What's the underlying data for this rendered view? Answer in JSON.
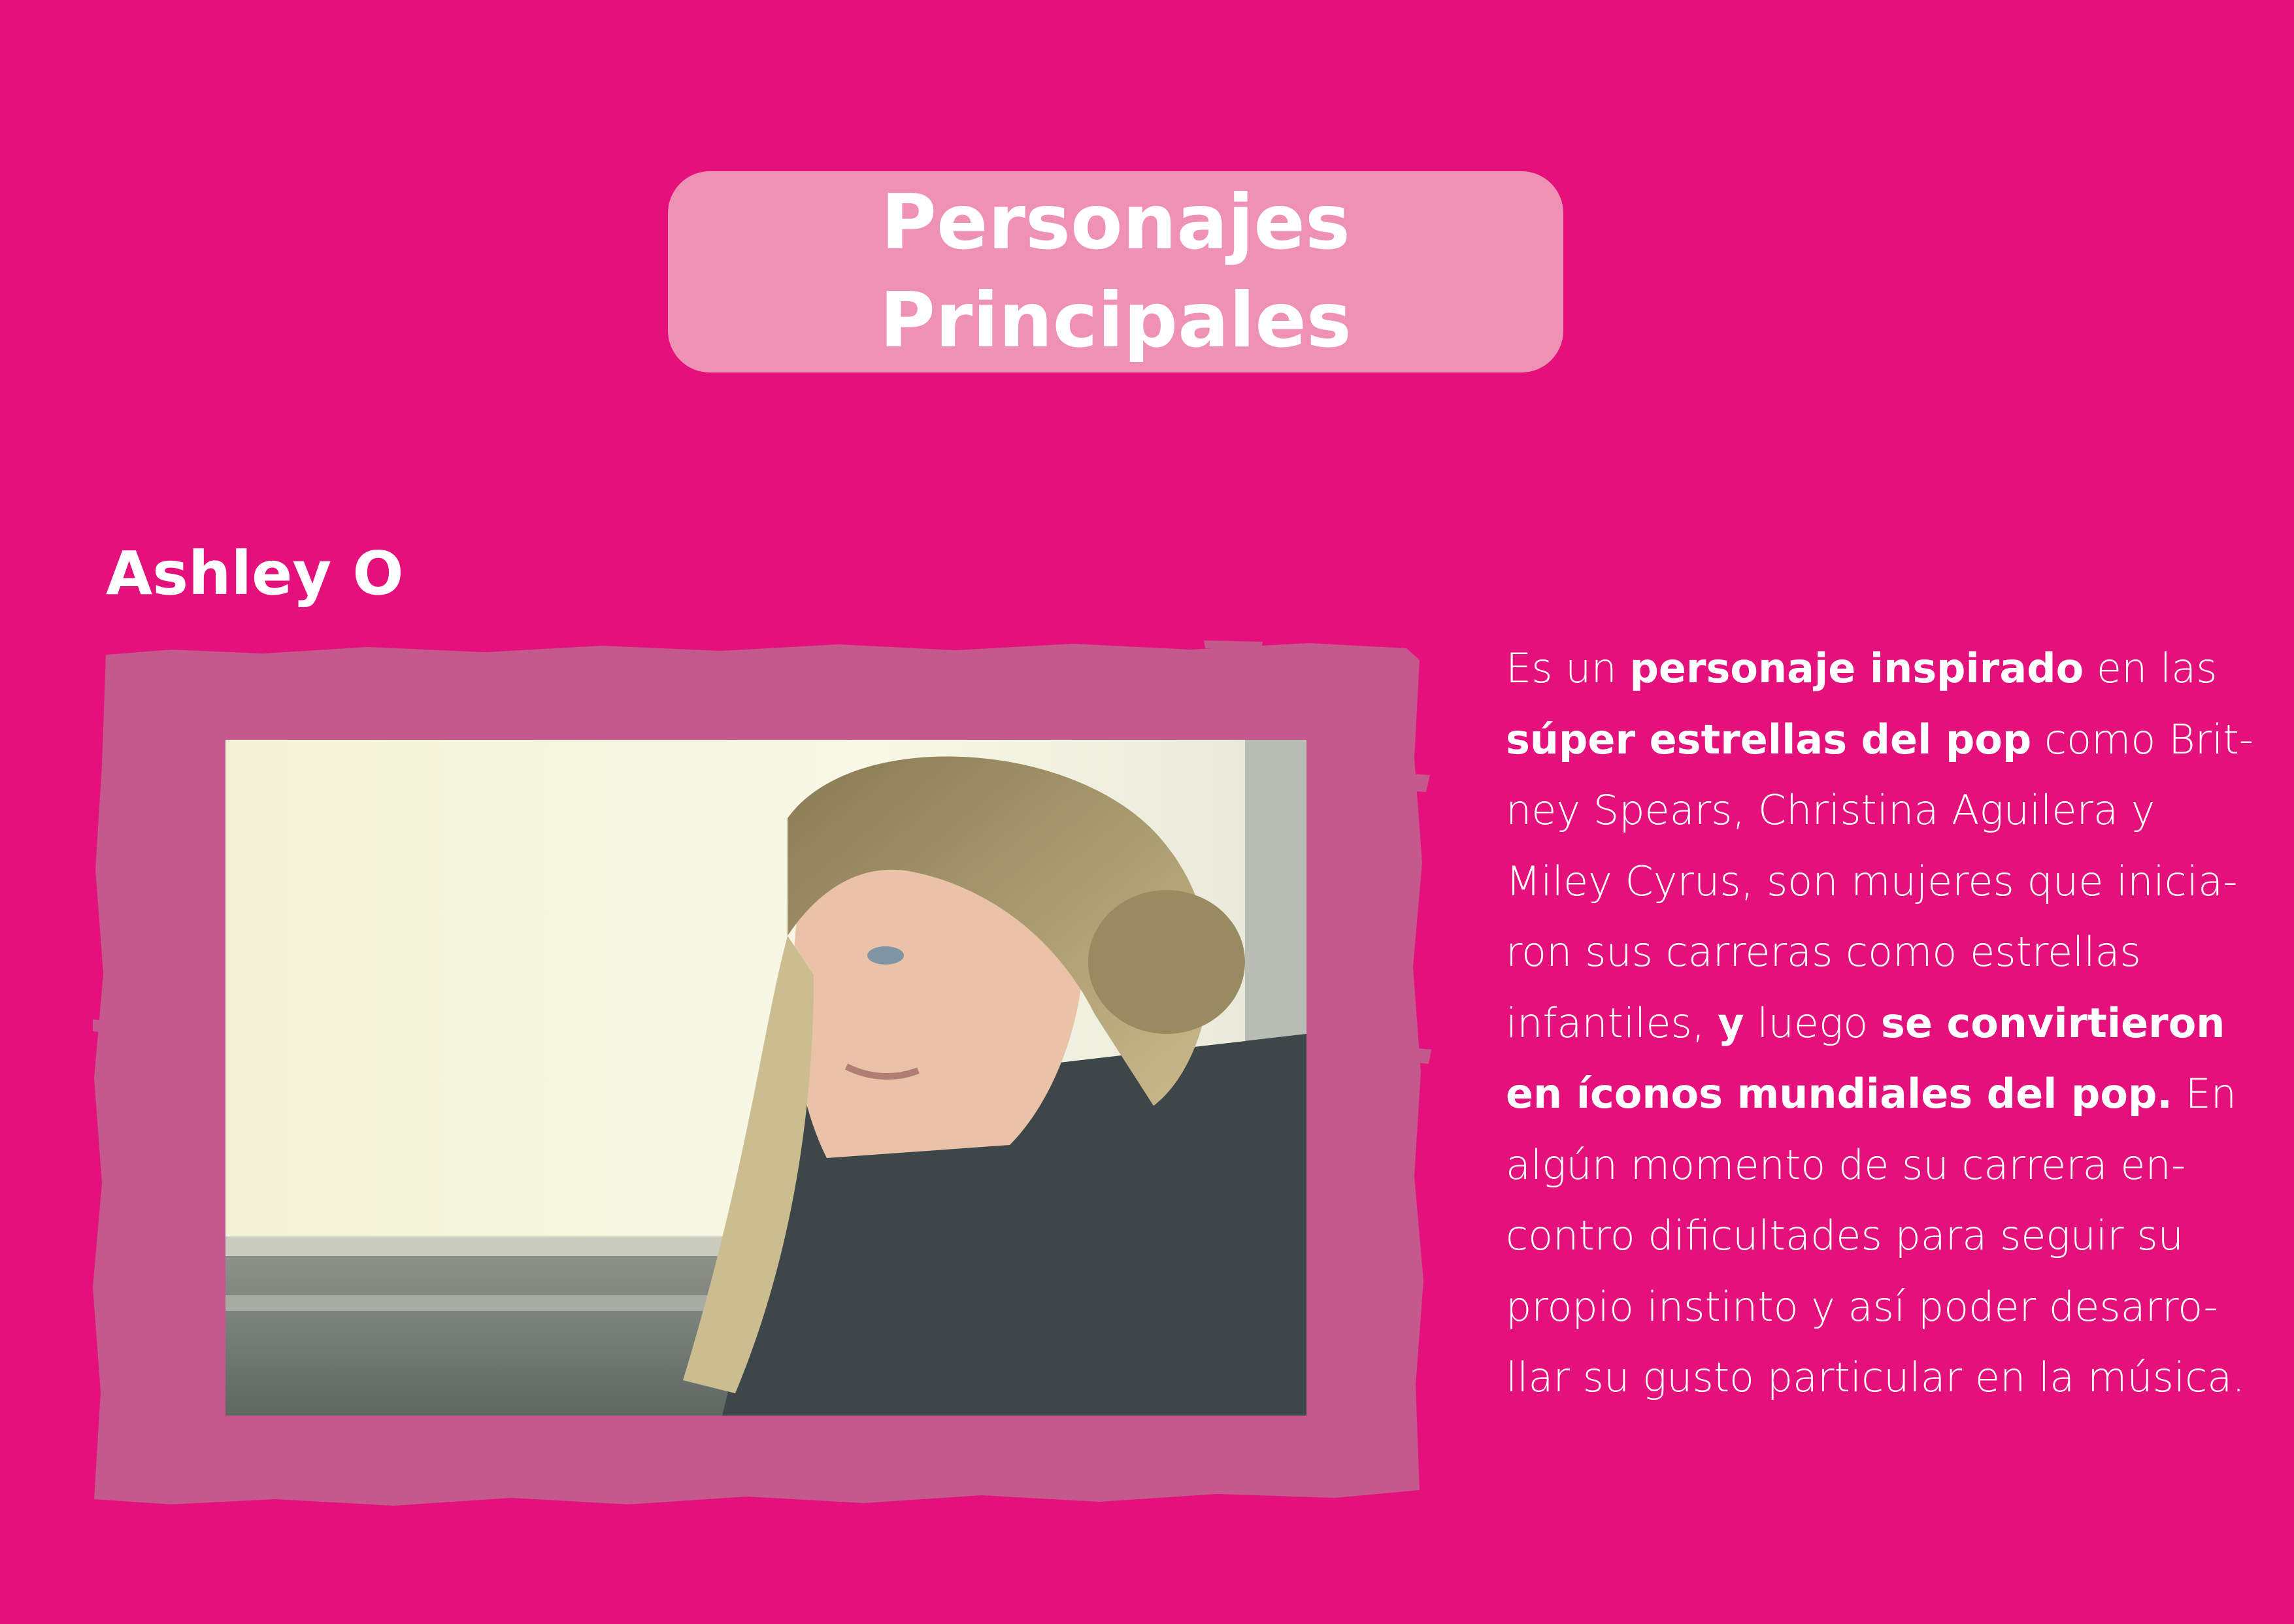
{
  "colors": {
    "background": "#e4117d",
    "title_pill": "#ee91b5",
    "frame": "#c5588d",
    "text": "#ffffff"
  },
  "header": {
    "title_line1": "Personajes",
    "title_line2": "Principales"
  },
  "character": {
    "name": "Ashley O",
    "photo_alt": "Ashley O",
    "description": [
      [
        {
          "t": "Es un "
        },
        {
          "t": "personaje inspirado",
          "b": true
        },
        {
          "t": " en las"
        }
      ],
      [
        {
          "t": "súper estrellas del pop",
          "b": true
        },
        {
          "t": " como Brit-"
        }
      ],
      [
        {
          "t": "ney Spears, Christina Aguilera y"
        }
      ],
      [
        {
          "t": "Miley Cyrus, son mujeres que inicia-"
        }
      ],
      [
        {
          "t": "ron sus carreras como estrellas"
        }
      ],
      [
        {
          "t": "infantiles, "
        },
        {
          "t": "y",
          "b": true
        },
        {
          "t": "  luego "
        },
        {
          "t": "se convirtieron",
          "b": true
        }
      ],
      [
        {
          "t": "en íconos mundiales del pop.",
          "b": true
        },
        {
          "t": " En"
        }
      ],
      [
        {
          "t": "algún momento de su carrera en-"
        }
      ],
      [
        {
          "t": "contro  dificultades para seguir su"
        }
      ],
      [
        {
          "t": "propio instinto y así poder  desarro-"
        }
      ],
      [
        {
          "t": "llar su gusto particular en la música."
        }
      ]
    ]
  }
}
